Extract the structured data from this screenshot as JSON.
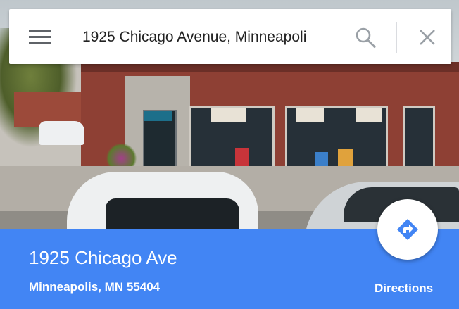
{
  "search": {
    "query": "1925 Chicago Avenue, Minneapoli",
    "menu_icon": "hamburger-menu-icon",
    "search_icon": "search-icon",
    "close_icon": "close-icon"
  },
  "place": {
    "title": "1925 Chicago Ave",
    "subtitle": "Minneapolis, MN 55404"
  },
  "directions": {
    "label": "Directions",
    "icon": "directions-diamond-icon"
  },
  "colors": {
    "panel": "#4285f4",
    "icon_gray": "#5f6368",
    "directions_icon": "#4285f4"
  }
}
